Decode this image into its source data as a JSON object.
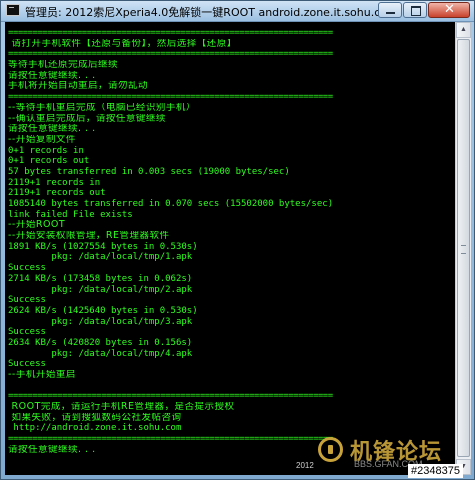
{
  "window": {
    "title": "管理员:  2012索尼Xperia4.0免解锁一键ROOT android.zone.it.sohu.com",
    "icon": "console-app-icon",
    "minimize_icon": "minimize-icon",
    "maximize_icon": "maximize-icon",
    "close_glyph": "✕",
    "close_icon": "close-icon"
  },
  "console": {
    "text_color": "#2eff1f",
    "background": "#000000",
    "lines": [
      {
        "text": "==================================================================",
        "kind": "rule"
      },
      {
        "text": " 请打开手机软件【还原与备份】，然后选择【还原】",
        "kind": "cjk"
      },
      {
        "text": "==================================================================",
        "kind": "rule"
      },
      {
        "text": "等待手机还原完成后继续",
        "kind": "cjk"
      },
      {
        "text": "请按任意键继续. . .",
        "kind": "cjk"
      },
      {
        "text": "手机将开始自动重启，请勿乱动",
        "kind": "cjk"
      },
      {
        "text": "==================================================================",
        "kind": "rule"
      },
      {
        "text": "--等待手机重启完成（电脑已经识别手机）",
        "kind": "cjk"
      },
      {
        "text": "--确认重启完成后，请按任意键继续",
        "kind": "cjk"
      },
      {
        "text": "请按任意键继续. . .",
        "kind": "cjk"
      },
      {
        "text": "--开始复制文件",
        "kind": "cjk"
      },
      {
        "text": "0+1 records in",
        "kind": "mono"
      },
      {
        "text": "0+1 records out",
        "kind": "mono"
      },
      {
        "text": "57 bytes transferred in 0.003 secs (19000 bytes/sec)",
        "kind": "mono"
      },
      {
        "text": "2119+1 records in",
        "kind": "mono"
      },
      {
        "text": "2119+1 records out",
        "kind": "mono"
      },
      {
        "text": "1085140 bytes transferred in 0.070 secs (15502000 bytes/sec)",
        "kind": "mono"
      },
      {
        "text": "link failed File exists",
        "kind": "mono"
      },
      {
        "text": "--开始ROOT",
        "kind": "cjk"
      },
      {
        "text": "--开始安装权限管理，RE管理器软件",
        "kind": "cjk"
      },
      {
        "text": "1891 KB/s (1027554 bytes in 0.530s)",
        "kind": "mono"
      },
      {
        "text": "        pkg: /data/local/tmp/1.apk",
        "kind": "mono"
      },
      {
        "text": "Success",
        "kind": "mono"
      },
      {
        "text": "2714 KB/s (173458 bytes in 0.062s)",
        "kind": "mono"
      },
      {
        "text": "        pkg: /data/local/tmp/2.apk",
        "kind": "mono"
      },
      {
        "text": "Success",
        "kind": "mono"
      },
      {
        "text": "2624 KB/s (1425640 bytes in 0.530s)",
        "kind": "mono"
      },
      {
        "text": "        pkg: /data/local/tmp/3.apk",
        "kind": "mono"
      },
      {
        "text": "Success",
        "kind": "mono"
      },
      {
        "text": "2634 KB/s (420820 bytes in 0.156s)",
        "kind": "mono"
      },
      {
        "text": "        pkg: /data/local/tmp/4.apk",
        "kind": "mono"
      },
      {
        "text": "Success",
        "kind": "mono"
      },
      {
        "text": "--手机开始重启",
        "kind": "cjk"
      },
      {
        "text": "",
        "kind": "mono"
      },
      {
        "text": "==================================================================",
        "kind": "rule"
      },
      {
        "text": " ROOT完成，请运行手机RE管理器，是否提示授权",
        "kind": "cjk"
      },
      {
        "text": " 如果失败，请到搜狐数码公社发帖咨询",
        "kind": "cjk"
      },
      {
        "text": " http://android.zone.it.sohu.com",
        "kind": "mono"
      },
      {
        "text": "==================================================================",
        "kind": "rule"
      },
      {
        "text": "请按任意键继续. . .",
        "kind": "cjk"
      }
    ]
  },
  "scrollbar": {
    "up_glyph": "▲",
    "down_glyph": "▼"
  },
  "watermark": {
    "text": "机锋论坛",
    "sub": "BBS.GFAN.COM",
    "year": "2012"
  },
  "post_id": "#2348375"
}
